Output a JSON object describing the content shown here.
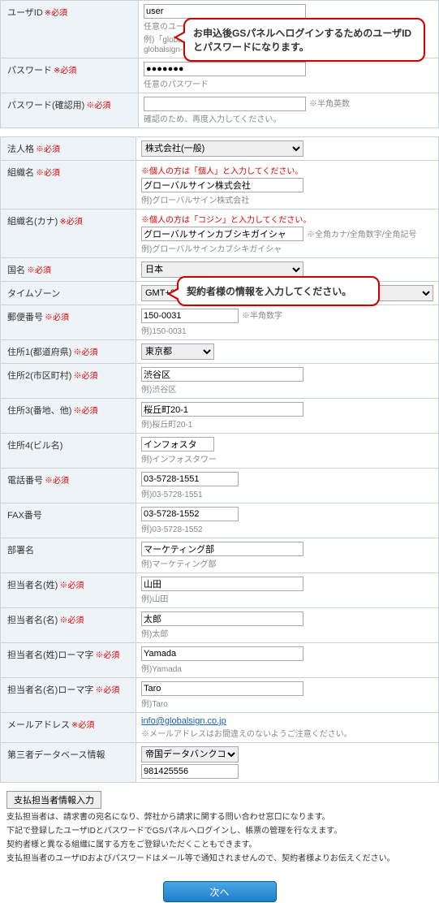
{
  "required_label": "※必須",
  "section1": {
    "user_id": {
      "label": "ユーザID",
      "value": "user",
      "hint1": "任意のユーザIDを入力",
      "hint2": "例)「globalsign」",
      "hint3": "globalsign-"
    },
    "password": {
      "label": "パスワード",
      "value": "●●●●●●●",
      "hint1": "任意のパスワード"
    },
    "password_confirm": {
      "label": "パスワード(確認用)",
      "suffix": "※半角英数",
      "hint": "確認のため、再度入力してください。"
    }
  },
  "section2": {
    "legal_type": {
      "label": "法人格",
      "value": "株式会社(一般)"
    },
    "org_name": {
      "label": "組織名",
      "note": "※個人の方は「個人」と入力してください。",
      "value": "グローバルサイン株式会社",
      "hint": "例)グローバルサイン株式会社"
    },
    "org_name_kana": {
      "label": "組織名(カナ)",
      "note": "※個人の方は「コジン」と入力してください。",
      "value": "グローバルサインカブシキガイシャ",
      "suffix": "※全角カナ/全角数字/全角記号",
      "hint": "例)グローバルサインカブシキガイシャ"
    },
    "country": {
      "label": "国名",
      "value": "日本"
    },
    "timezone": {
      "label": "タイムゾーン",
      "value": "GMT+09:00 大阪、札幌、東京"
    },
    "postal": {
      "label": "郵便番号",
      "value": "150-0031",
      "suffix": "※半角数字",
      "hint": "例)150-0031"
    },
    "addr1": {
      "label": "住所1(都道府県)",
      "value": "東京都"
    },
    "addr2": {
      "label": "住所2(市区町村)",
      "value": "渋谷区",
      "hint": "例)渋谷区"
    },
    "addr3": {
      "label": "住所3(番地、他)",
      "value": "桜丘町20-1",
      "hint": "例)桜丘町20-1"
    },
    "addr4": {
      "label": "住所4(ビル名)",
      "value": "インフォスタ",
      "hint": "例)インフォスタワー"
    },
    "tel": {
      "label": "電話番号",
      "value": "03-5728-1551",
      "hint": "例)03-5728-1551"
    },
    "fax": {
      "label": "FAX番号",
      "value": "03-5728-1552",
      "hint": "例)03-5728-1552"
    },
    "dept": {
      "label": "部署名",
      "value": "マーケティング部",
      "hint": "例)マーケティング部"
    },
    "surname": {
      "label": "担当者名(姓)",
      "value": "山田",
      "hint": "例)山田"
    },
    "given": {
      "label": "担当者名(名)",
      "value": "太郎",
      "hint": "例)太郎"
    },
    "surname_r": {
      "label": "担当者名(姓)ローマ字",
      "value": "Yamada",
      "hint": "例)Yamada"
    },
    "given_r": {
      "label": "担当者名(名)ローマ字",
      "value": "Taro",
      "hint": "例)Taro"
    },
    "email": {
      "label": "メールアドレス",
      "value": "info@globalsign.co.jp",
      "hint": "※メールアドレスはお間違えのないようご注意ください。"
    },
    "thirdparty": {
      "label": "第三者データベース情報",
      "select": "帝国データバンクコード",
      "value": "981425556"
    }
  },
  "btn_pay": "支払担当者情報入力",
  "footer": {
    "l1": "支払担当者は、請求書の宛名になり、弊社から請求に関する問い合わせ窓口になります。",
    "l2": "下記で登録したユーザIDとパスワードでGSパネルへログインし、帳票の管理を行なえます。",
    "l3": "契約者様と異なる組織に属する方をご登録いただくこともできます。",
    "l4": "支払担当者のユーザIDおよびパスワードはメール等で通知されませんので、契約者様よりお伝えください。"
  },
  "btn_next": "次へ",
  "callout1": "お申込後GSパネルへログインするためのユーザIDとパスワードになります。",
  "callout2": "契約者様の情報を入力してください。"
}
